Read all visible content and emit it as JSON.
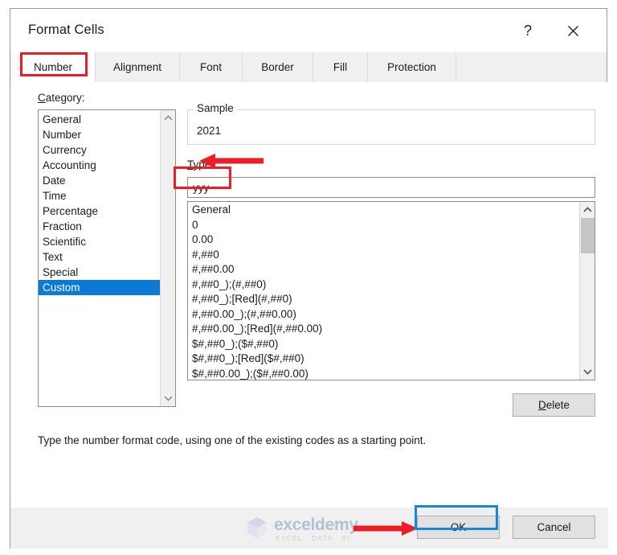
{
  "window": {
    "title": "Format Cells",
    "help_icon": "question-mark-icon",
    "close_icon": "close-icon"
  },
  "tabs": [
    {
      "label": "Number",
      "active": true
    },
    {
      "label": "Alignment",
      "active": false
    },
    {
      "label": "Font",
      "active": false
    },
    {
      "label": "Border",
      "active": false
    },
    {
      "label": "Fill",
      "active": false
    },
    {
      "label": "Protection",
      "active": false
    }
  ],
  "category": {
    "label": "Category:",
    "label_underlined_char": "C",
    "items": [
      "General",
      "Number",
      "Currency",
      "Accounting",
      "Date",
      "Time",
      "Percentage",
      "Fraction",
      "Scientific",
      "Text",
      "Special",
      "Custom"
    ],
    "selected": "Custom"
  },
  "sample": {
    "legend": "Sample",
    "value": "2021"
  },
  "type": {
    "label": "Type:",
    "label_underlined_char": "T",
    "input_value": "yyy",
    "input_placeholder": "",
    "items": [
      "General",
      "0",
      "0.00",
      "#,##0",
      "#,##0.00",
      "#,##0_);(#,##0)",
      "#,##0_);[Red](#,##0)",
      "#,##0.00_);(#,##0.00)",
      "#,##0.00_);[Red](#,##0.00)",
      "$#,##0_);($#,##0)",
      "$#,##0_);[Red]($#,##0)",
      "$#,##0.00_);($#,##0.00)"
    ]
  },
  "buttons": {
    "delete": "Delete",
    "delete_underlined_char": "D",
    "ok": "OK",
    "cancel": "Cancel"
  },
  "help_text": "Type the number format code, using one of the existing codes as a starting point.",
  "watermark": {
    "name": "exceldemy",
    "tagline": "EXCEL  ·  DATA  ·  BI",
    "icon": "exceldemy-logo-icon"
  },
  "annotations": {
    "number_tab_highlight_color": "#ee1c25",
    "type_input_highlight_color": "#ee1c25",
    "ok_button_highlight_color": "#1787d8",
    "arrow_color": "#ee1c25",
    "arrow_to_type_label": "arrow-pointing-to-type-label",
    "arrow_to_ok_button": "arrow-pointing-to-ok-button"
  },
  "colors": {
    "selection_blue": "#0b7ad6",
    "dialog_face": "#f0f0f0",
    "panel_white": "#ffffff"
  }
}
